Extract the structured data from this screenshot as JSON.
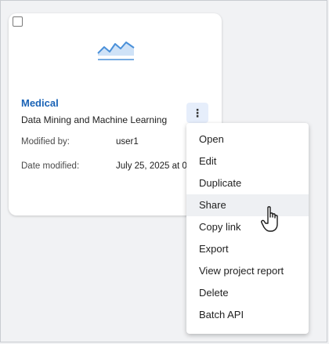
{
  "card": {
    "title": "Medical",
    "subtitle": "Data Mining and Machine Learning",
    "modified_by_label": "Modified by:",
    "modified_by_value": "user1",
    "date_modified_label": "Date modified:",
    "date_modified_value": "July 25, 2025 at 0",
    "thumbnail_icon": "line-chart-icon",
    "accent_color": "#1a63b6"
  },
  "menu": {
    "items": [
      {
        "label": "Open"
      },
      {
        "label": "Edit"
      },
      {
        "label": "Duplicate"
      },
      {
        "label": "Share"
      },
      {
        "label": "Copy link"
      },
      {
        "label": "Export"
      },
      {
        "label": "View project report"
      },
      {
        "label": "Delete"
      },
      {
        "label": "Batch API"
      }
    ],
    "hovered_item": "Share"
  },
  "icons": {
    "kebab": "more-vertical-icon",
    "cursor": "hand-pointer-icon"
  }
}
